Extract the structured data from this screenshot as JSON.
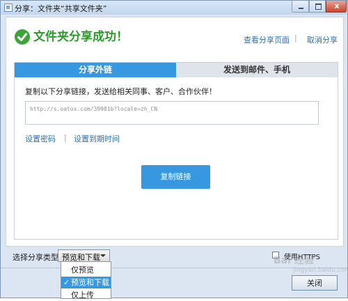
{
  "window": {
    "title": "分享：文件夹“共享文件夹”",
    "close_glyph": "x"
  },
  "header": {
    "success_message": "文件夹分享成功！",
    "view_share_page": "查看分享页面",
    "separator": "|",
    "cancel_share": "取消分享"
  },
  "tabs": [
    {
      "label": "分享外链",
      "active": true
    },
    {
      "label": "发送到邮件、手机",
      "active": false
    }
  ],
  "share_link": {
    "description": "复制以下分享链接，发送给相关同事、客户、合作伙伴！",
    "url": "http://s.oatos.com/39981b?locale=zh_CN",
    "set_password": "设置密码",
    "separator": "|",
    "set_expiry": "设置到期时间",
    "copy_button": "复制链接"
  },
  "footer": {
    "type_label": "选择分享类型",
    "selected_type": "预览和下载",
    "https_label": "使用HTTPS",
    "https_checked": false,
    "close_button": "关闭"
  },
  "dropdown": {
    "options": [
      {
        "label": "仅预览",
        "selected": false
      },
      {
        "label": "预览和下载",
        "selected": true
      },
      {
        "label": "仅上传",
        "selected": false
      }
    ],
    "check_glyph": "✓"
  },
  "watermark": {
    "text": "Bai 经验",
    "sub": "jingyan.baidu.com"
  },
  "colors": {
    "accent": "#3898df",
    "success": "#2e9a2e",
    "link": "#2a72b5"
  }
}
